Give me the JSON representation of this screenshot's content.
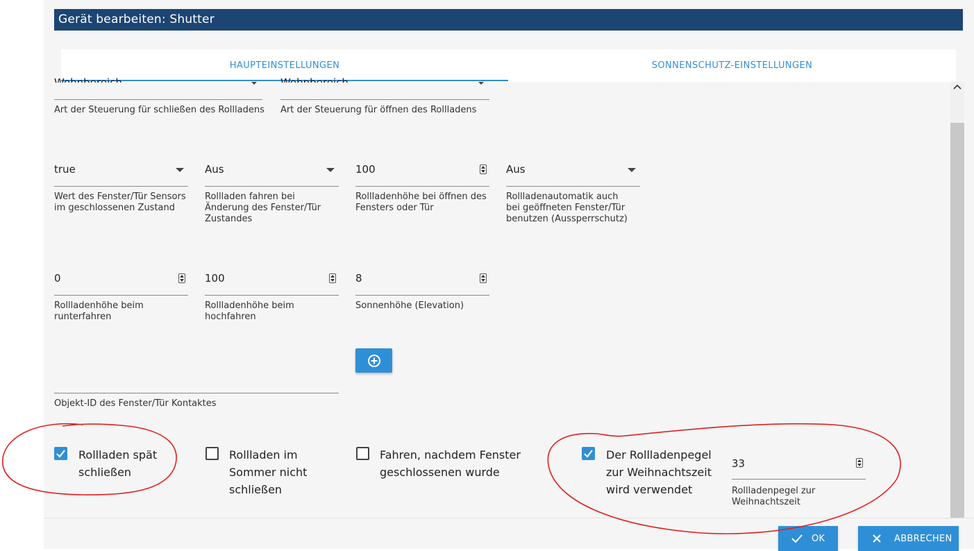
{
  "dialog": {
    "title": "Gerät bearbeiten: Shutter"
  },
  "tabs": [
    {
      "label": "HAUPTEINSTELLUNGEN",
      "active": true
    },
    {
      "label": "SONNENSCHUTZ-EINSTELLUNGEN",
      "active": false
    }
  ],
  "row1": [
    {
      "value": "Wohnbereich",
      "hint": "Art der Steuerung für schließen des Rollladens"
    },
    {
      "value": "Wohnbereich",
      "hint": "Art der Steuerung für öffnen des Rollladens"
    }
  ],
  "row2": [
    {
      "value": "true",
      "hint": "Wert des Fenster/Tür Sensors im geschlossenen Zustand"
    },
    {
      "value": "Aus",
      "hint": "Rollladen fahren bei Änderung des Fenster/Tür Zustandes"
    },
    {
      "value": "100",
      "hint": "Rollladenhöhe bei öffnen des Fensters oder Tür"
    },
    {
      "value": "Aus",
      "hint": "Rollladenautomatik auch bei geöffneten Fenster/Tür benutzen (Aussperrschutz)"
    }
  ],
  "row3": [
    {
      "value": "0",
      "hint": "Rollladenhöhe beim runterfahren"
    },
    {
      "value": "100",
      "hint": "Rollladenhöhe beim hochfahren"
    },
    {
      "value": "8",
      "hint": "Sonnenhöhe (Elevation)"
    }
  ],
  "object_id": {
    "value": "",
    "hint": "Objekt-ID des Fenster/Tür Kontaktes"
  },
  "checkboxes": [
    {
      "label": "Rollladen spät schließen",
      "checked": true
    },
    {
      "label": "Rollladen im Sommer nicht schließen",
      "checked": false
    },
    {
      "label": "Fahren, nachdem Fenster geschlossenen wurde",
      "checked": false
    },
    {
      "label": "Der Rollladenpegel zur Weihnachtszeit wird verwendet",
      "checked": true
    }
  ],
  "christmas_level": {
    "value": "33",
    "hint": "Rollladenpegel zur Weihnachtszeit"
  },
  "buttons": {
    "ok": "OK",
    "cancel": "ABBRECHEN"
  },
  "colors": {
    "title_bg": "#1c4573",
    "accent": "#2f8fd6",
    "annotation": "#e02020"
  },
  "icons": [
    "chevron-up-icon",
    "dropdown-caret-icon",
    "spinner-icon",
    "checkbox-icon",
    "plus-circle-icon",
    "check-icon",
    "close-icon"
  ]
}
